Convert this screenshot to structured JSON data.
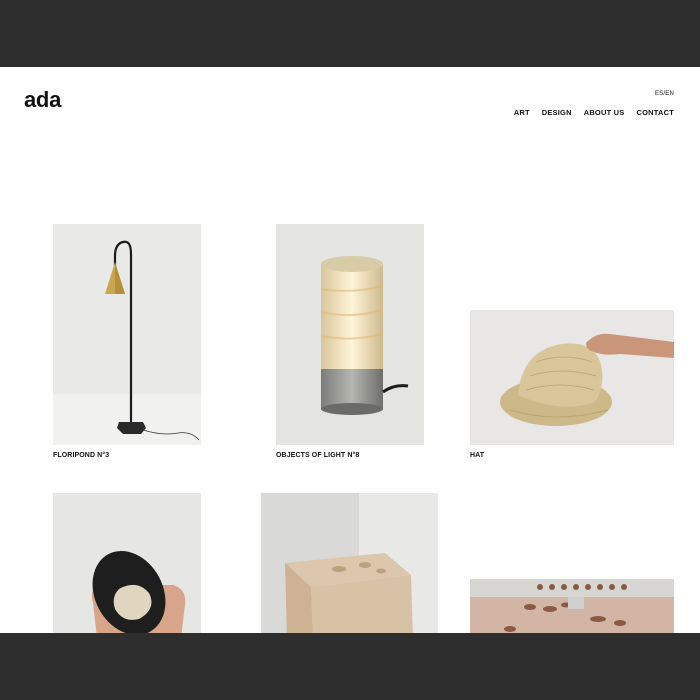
{
  "header": {
    "logo": "ada",
    "language_switch": "ES/EN",
    "nav": [
      "ART",
      "DESIGN",
      "ABOUT US",
      "CONTACT"
    ]
  },
  "gallery": {
    "items": [
      {
        "caption": "FLORIPOND N°3"
      },
      {
        "caption": "OBJECTS OF LIGHT N°8"
      },
      {
        "caption": "HAT"
      },
      {
        "caption": ""
      },
      {
        "caption": ""
      },
      {
        "caption": ""
      }
    ]
  },
  "colors": {
    "page_background": "#ffffff",
    "frame": "#2e2e2e",
    "text": "#111111"
  }
}
